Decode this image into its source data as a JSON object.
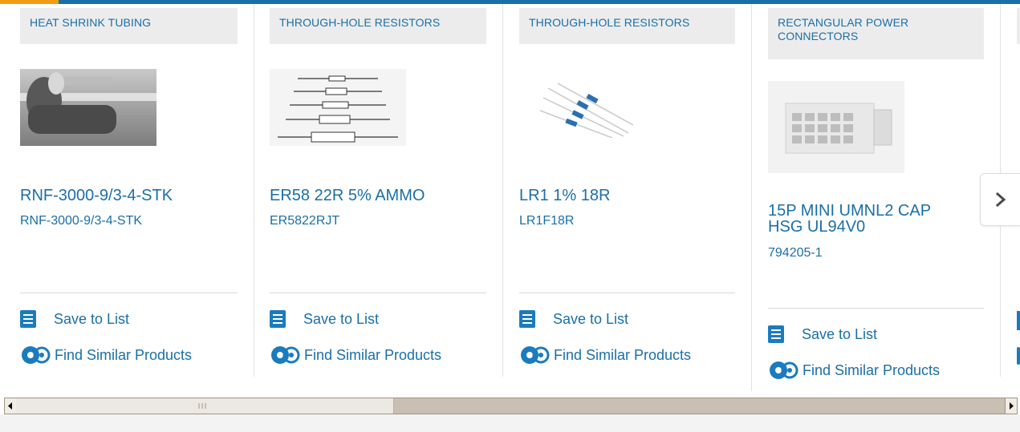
{
  "products": [
    {
      "category": "HEAT SHRINK TUBING",
      "title": "RNF-3000-9/3-4-STK",
      "part_number": "RNF-3000-9/3-4-STK",
      "save_label": "Save to List",
      "similar_label": "Find Similar Products"
    },
    {
      "category": "THROUGH-HOLE RESISTORS",
      "title": "ER58 22R 5% AMMO",
      "part_number": "ER5822RJT",
      "save_label": "Save to List",
      "similar_label": "Find Similar Products"
    },
    {
      "category": "THROUGH-HOLE RESISTORS",
      "title": "LR1 1% 18R",
      "part_number": "LR1F18R",
      "save_label": "Save to List",
      "similar_label": "Find Similar Products"
    },
    {
      "category": "RECTANGULAR POWER CONNECTORS",
      "title": "15P MINI UMNL2 CAP HSG UL94V0",
      "part_number": "794205-1",
      "save_label": "Save to List",
      "similar_label": "Find Similar Products"
    }
  ],
  "colors": {
    "accent": "#1a6fa8",
    "icon": "#1b7bbf",
    "top_accent": "#f39c12"
  },
  "icons": {
    "save": "checklist-icon",
    "similar": "gears-icon",
    "next": "chevron-right-icon"
  }
}
